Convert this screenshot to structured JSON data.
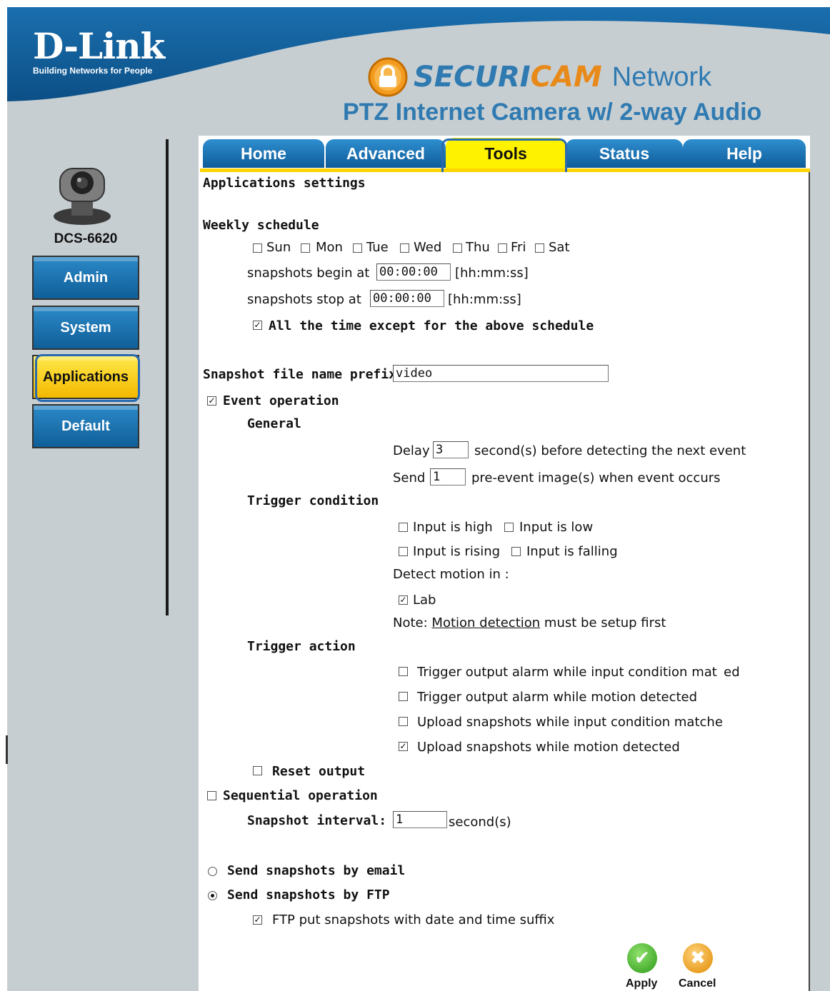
{
  "brand": {
    "logo": "D-Link",
    "tagline": "Building Networks for People",
    "product_secur": "SECURI",
    "product_cam": "CAM",
    "product_network": "Network",
    "product_title": "PTZ Internet Camera w/ 2-way Audio",
    "model": "DCS-6620"
  },
  "tabs": [
    {
      "label": "Home"
    },
    {
      "label": "Advanced"
    },
    {
      "label": "Tools",
      "active": true
    },
    {
      "label": "Status"
    },
    {
      "label": "Help"
    }
  ],
  "sidebar": [
    {
      "label": "Admin"
    },
    {
      "label": "System"
    },
    {
      "label": "Applications",
      "active": true
    },
    {
      "label": "Default"
    }
  ],
  "form": {
    "section_title": "Applications settings",
    "weekly_schedule": {
      "label": "Weekly schedule",
      "days": [
        {
          "label": "Sun",
          "checked": false
        },
        {
          "label": "Mon",
          "checked": false
        },
        {
          "label": "Tue",
          "checked": false
        },
        {
          "label": "Wed",
          "checked": false
        },
        {
          "label": "Thu",
          "checked": false
        },
        {
          "label": "Fri",
          "checked": false
        },
        {
          "label": "Sat",
          "checked": false
        }
      ],
      "begin_label": "snapshots begin at",
      "begin_value": "00:00:00",
      "stop_label": "snapshots stop at",
      "stop_value": "00:00:00",
      "time_format": "[hh:mm:ss]",
      "except_label": "All the time except for the above schedule",
      "except_checked": true
    },
    "prefix_label": "Snapshot file name prefix",
    "prefix_value": "video",
    "event_operation": {
      "label": "Event operation",
      "checked": true,
      "general_label": "General",
      "delay_label": "Delay",
      "delay_value": "3",
      "delay_suffix": "second(s) before detecting the next event",
      "send_label": "Send",
      "send_value": "1",
      "send_suffix": "pre-event image(s) when event occurs",
      "trigger_condition_label": "Trigger condition",
      "conditions": [
        {
          "label": "Input is high",
          "checked": false
        },
        {
          "label": "Input is low",
          "checked": false
        },
        {
          "label": "Input is rising",
          "checked": false
        },
        {
          "label": "Input is falling",
          "checked": false
        }
      ],
      "detect_motion_label": "Detect motion in :",
      "motion_windows": [
        {
          "label": "Lab",
          "checked": true
        }
      ],
      "note_prefix": "Note:",
      "note_link": "Motion detection",
      "note_suffix": "must be setup first",
      "trigger_action_label": "Trigger action",
      "actions": [
        {
          "label": "Trigger output alarm while input condition mat  ed",
          "checked": false
        },
        {
          "label": "Trigger output alarm while motion detected",
          "checked": false
        },
        {
          "label": "Upload snapshots while input condition matche",
          "checked": false
        },
        {
          "label": "Upload snapshots while motion detected",
          "checked": true
        }
      ],
      "reset_output_label": "Reset output",
      "reset_output_checked": false
    },
    "sequential_operation": {
      "label": "Sequential operation",
      "checked": false,
      "interval_label": "Snapshot interval:",
      "interval_value": "1",
      "interval_suffix": "second(s)"
    },
    "delivery": {
      "email_label": "Send snapshots by email",
      "email_selected": false,
      "ftp_label": "Send snapshots by FTP",
      "ftp_selected": true,
      "ftp_suffix_label": "FTP put snapshots with date and time suffix",
      "ftp_suffix_checked": true
    },
    "apply_label": "Apply",
    "cancel_label": "Cancel"
  },
  "colors": {
    "header_blue": "#0e5c99",
    "tab_blue": "#1f7cc0",
    "active_yellow": "#fff200",
    "highlight_ring": "#2a6bb0",
    "side_bg": "#c7ced2"
  }
}
